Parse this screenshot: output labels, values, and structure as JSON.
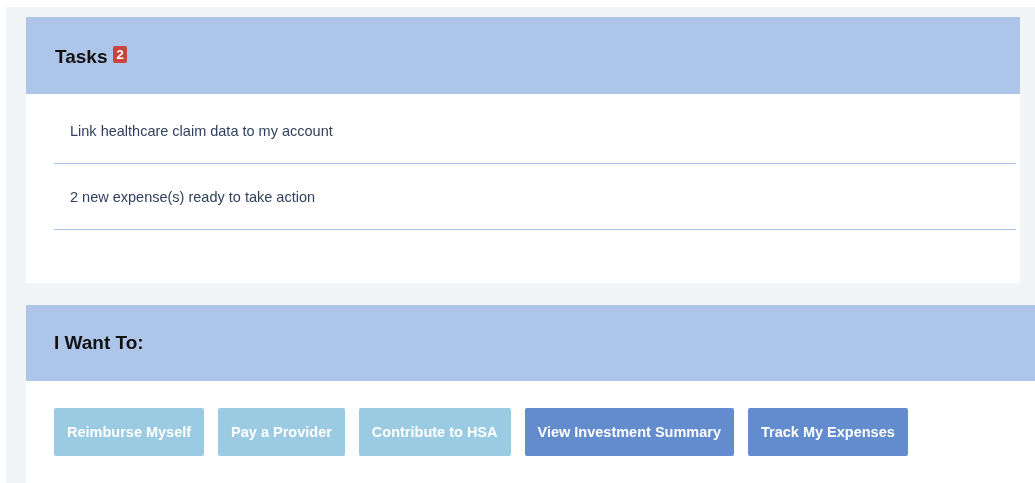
{
  "tasks": {
    "title": "Tasks",
    "badge": "2",
    "items": [
      "Link healthcare claim data to my account",
      "2 new expense(s) ready to take action"
    ]
  },
  "actions": {
    "title": "I Want To:",
    "buttons": [
      {
        "label": "Reimburse Myself",
        "kind": "light"
      },
      {
        "label": "Pay a Provider",
        "kind": "light"
      },
      {
        "label": "Contribute to HSA",
        "kind": "light"
      },
      {
        "label": "View Investment Summary",
        "kind": "dark"
      },
      {
        "label": "Track My Expenses",
        "kind": "dark"
      }
    ]
  }
}
